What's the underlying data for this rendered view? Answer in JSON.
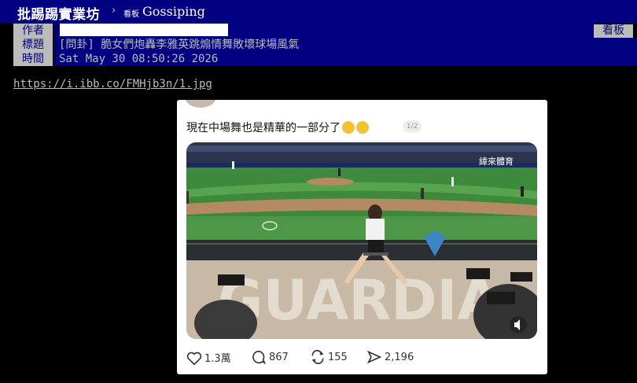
{
  "topbar": {
    "board_title": "批踢踢實業坊",
    "separator": "›",
    "board_tag": "看板",
    "board_name": "Gossiping"
  },
  "meta": {
    "author_label": "作者",
    "title_label": "標題",
    "time_label": "時間",
    "title_value": "[問卦] 脆女們炮轟李雅英跳煽情舞敗壞球場風氣",
    "time_value": "Sat May 30 08:50:26 2026",
    "board_button": "看板"
  },
  "link": "https://i.ibb.co/FMHjb3n/1.jpg",
  "post_card": {
    "text": "現在中場舞也是精華的一部分了",
    "page_indicator": "1/2",
    "photo_watermark": "緯來體育",
    "stats": {
      "likes": "1.3萬",
      "comments": "867",
      "reposts": "155",
      "shares": "2,196"
    }
  }
}
